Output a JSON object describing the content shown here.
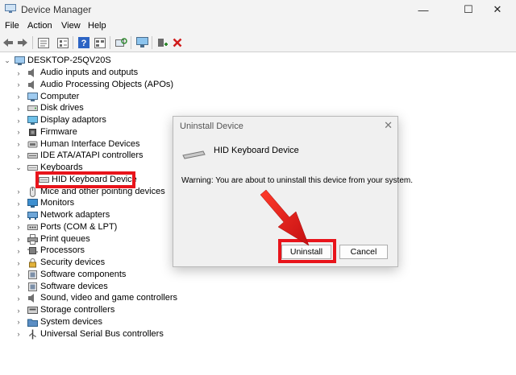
{
  "window": {
    "title": "Device Manager",
    "minimize_glyph": "—",
    "maximize_glyph": "☐",
    "close_glyph": "✕"
  },
  "menu": [
    "File",
    "Action",
    "View",
    "Help"
  ],
  "toolbar": [
    "back-icon",
    "forward-icon",
    "properties-icon",
    "tree-view-icon",
    "help-icon",
    "resources-icon",
    "scan-hardware-icon",
    "monitor-icon",
    "add-driver-icon",
    "uninstall-x-icon"
  ],
  "tree": {
    "root": "DESKTOP-25QV20S",
    "items": [
      {
        "label": "Audio inputs and outputs",
        "icon": "speaker-icon",
        "expanded": false
      },
      {
        "label": "Audio Processing Objects (APOs)",
        "icon": "speaker-icon",
        "expanded": false
      },
      {
        "label": "Computer",
        "icon": "computer-icon",
        "expanded": false
      },
      {
        "label": "Disk drives",
        "icon": "disk-icon",
        "expanded": false
      },
      {
        "label": "Display adaptors",
        "icon": "display-icon",
        "expanded": false
      },
      {
        "label": "Firmware",
        "icon": "chip-icon",
        "expanded": false
      },
      {
        "label": "Human Interface Devices",
        "icon": "hid-icon",
        "expanded": false
      },
      {
        "label": "IDE ATA/ATAPI controllers",
        "icon": "ide-icon",
        "expanded": false
      },
      {
        "label": "Keyboards",
        "icon": "keyboard-icon",
        "expanded": true
      },
      {
        "label": "HID Keyboard Device",
        "icon": "keyboard-icon",
        "child": true
      },
      {
        "label": "Mice and other pointing devices",
        "icon": "mouse-icon",
        "expanded": false
      },
      {
        "label": "Monitors",
        "icon": "monitor-icon",
        "expanded": false
      },
      {
        "label": "Network adapters",
        "icon": "network-icon",
        "expanded": false
      },
      {
        "label": "Ports (COM & LPT)",
        "icon": "port-icon",
        "expanded": false
      },
      {
        "label": "Print queues",
        "icon": "printer-icon",
        "expanded": false
      },
      {
        "label": "Processors",
        "icon": "cpu-icon",
        "expanded": false
      },
      {
        "label": "Security devices",
        "icon": "security-icon",
        "expanded": false
      },
      {
        "label": "Software components",
        "icon": "software-icon",
        "expanded": false
      },
      {
        "label": "Software devices",
        "icon": "software-icon",
        "expanded": false
      },
      {
        "label": "Sound, video and game controllers",
        "icon": "speaker-icon",
        "expanded": false
      },
      {
        "label": "Storage controllers",
        "icon": "storage-icon",
        "expanded": false
      },
      {
        "label": "System devices",
        "icon": "folder-icon",
        "expanded": false
      },
      {
        "label": "Universal Serial Bus controllers",
        "icon": "usb-icon",
        "expanded": false
      }
    ]
  },
  "dialog": {
    "title": "Uninstall Device",
    "device_name": "HID Keyboard Device",
    "warning": "Warning: You are about to uninstall this device from your system.",
    "uninstall_label": "Uninstall",
    "cancel_label": "Cancel"
  },
  "colors": {
    "highlight": "#e8141b",
    "toolbar_red_x": "#d01c1c"
  }
}
